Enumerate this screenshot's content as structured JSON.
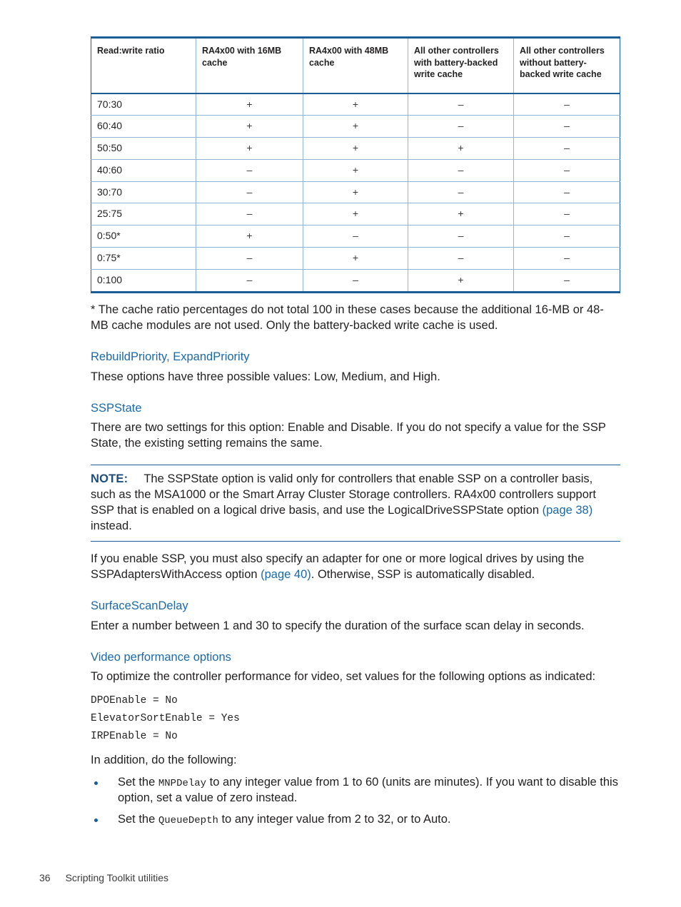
{
  "table": {
    "headers": [
      "Read:write ratio",
      "RA4x00 with 16MB cache",
      "RA4x00 with 48MB cache",
      "All other controllers with battery-backed write cache",
      "All other controllers without battery-backed write cache"
    ],
    "rows": [
      {
        "ratio": "70:30",
        "c1": "+",
        "c2": "+",
        "c3": "–",
        "c4": "–"
      },
      {
        "ratio": "60:40",
        "c1": "+",
        "c2": "+",
        "c3": "–",
        "c4": "–"
      },
      {
        "ratio": "50:50",
        "c1": "+",
        "c2": "+",
        "c3": "+",
        "c4": "–"
      },
      {
        "ratio": "40:60",
        "c1": "–",
        "c2": "+",
        "c3": "–",
        "c4": "–"
      },
      {
        "ratio": "30:70",
        "c1": "–",
        "c2": "+",
        "c3": "–",
        "c4": "–"
      },
      {
        "ratio": "25:75",
        "c1": "–",
        "c2": "+",
        "c3": "+",
        "c4": "–"
      },
      {
        "ratio": "0:50*",
        "c1": "+",
        "c2": "–",
        "c3": "–",
        "c4": "–"
      },
      {
        "ratio": "0:75*",
        "c1": "–",
        "c2": "+",
        "c3": "–",
        "c4": "–"
      },
      {
        "ratio": "0:100",
        "c1": "–",
        "c2": "–",
        "c3": "+",
        "c4": "–"
      }
    ]
  },
  "footnote": "* The cache ratio percentages do not total 100 in these cases because the additional 16-MB or 48-MB cache modules are not used. Only the battery-backed write cache is used.",
  "sections": {
    "rebuild": {
      "heading": "RebuildPriority, ExpandPriority",
      "body": "These options have three possible values: Low, Medium, and High."
    },
    "sspstate": {
      "heading": "SSPState",
      "body": "There are two settings for this option: Enable and Disable. If you do not specify a value for the SSP State, the existing setting remains the same.",
      "note": {
        "label": "NOTE:",
        "text_before_link": "The SSPState option is valid only for controllers that enable SSP on a controller basis, such as the MSA1000 or the Smart Array Cluster Storage controllers. RA4x00 controllers support SSP that is enabled on a logical drive basis, and use the LogicalDriveSSPState option ",
        "link": "(page 38)",
        "text_after_link": " instead."
      },
      "after_note_before_link": "If you enable SSP, you must also specify an adapter for one or more logical drives by using the SSPAdaptersWithAccess option ",
      "after_note_link": "(page 40)",
      "after_note_after_link": ". Otherwise, SSP is automatically disabled."
    },
    "surfacescan": {
      "heading": "SurfaceScanDelay",
      "body": "Enter a number between 1 and 30 to specify the duration of the surface scan delay in seconds."
    },
    "video": {
      "heading": "Video performance options",
      "intro": "To optimize the controller performance for video, set values for the following options as indicated:",
      "code_lines": [
        "DPOEnable = No",
        "ElevatorSortEnable = Yes",
        "IRPEnable = No"
      ],
      "addition_intro": "In addition, do the following:",
      "bullets": [
        {
          "prefix": "Set the ",
          "code": "MNPDelay",
          "suffix": " to any integer value from 1 to 60 (units are minutes). If you want to disable this option, set a value of zero instead."
        },
        {
          "prefix": "Set the ",
          "code": "QueueDepth",
          "suffix": " to any integer value from 2 to 32, or to Auto."
        }
      ]
    }
  },
  "footer": {
    "page_number": "36",
    "chapter": "Scripting Toolkit utilities"
  },
  "colors": {
    "heading_blue": "#1a6aa8",
    "rule_blue": "#1b5d96",
    "note_label_blue": "#1f4e79",
    "cell_border_blue": "#8fb6d6",
    "text": "#221f1f"
  }
}
